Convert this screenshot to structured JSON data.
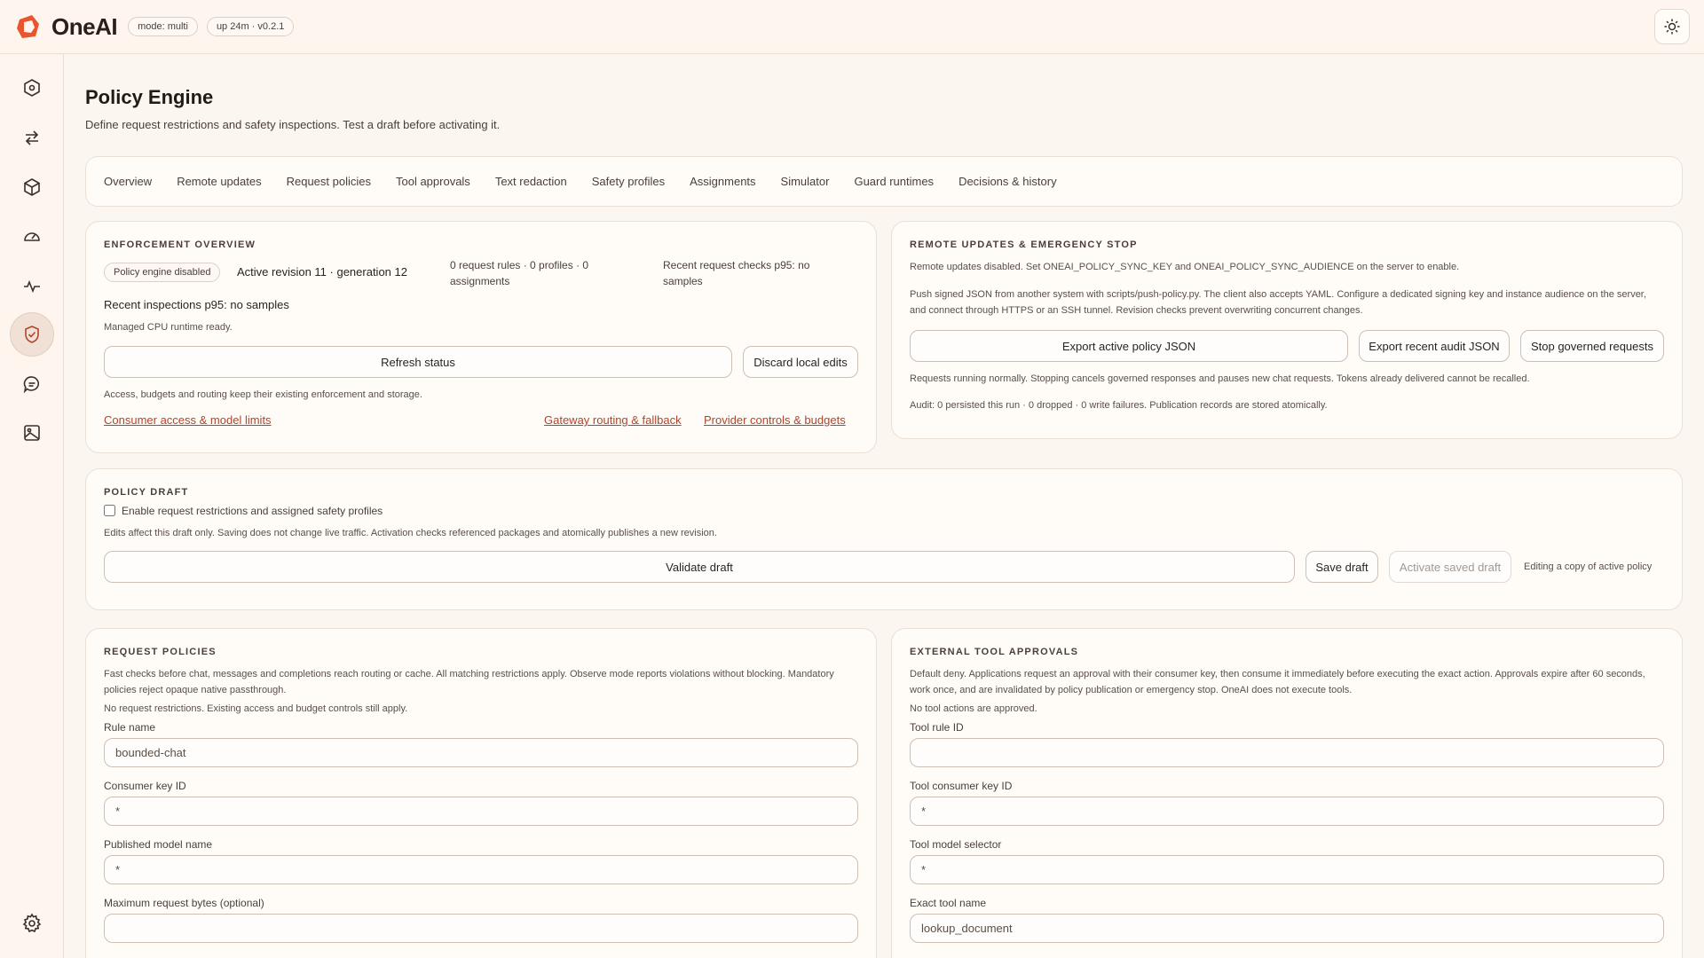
{
  "header": {
    "brand": "OneAI",
    "mode_pill": "mode: multi",
    "uptime_pill": "up 24m · v0.2.1",
    "theme_icon": "sun-icon"
  },
  "sidebar": {
    "items": [
      {
        "icon": "hub-icon"
      },
      {
        "icon": "arrows-swap-icon"
      },
      {
        "icon": "cube-icon"
      },
      {
        "icon": "gauge-icon"
      },
      {
        "icon": "pulse-icon"
      },
      {
        "icon": "shield-check-icon",
        "active": true
      },
      {
        "icon": "chat-icon"
      },
      {
        "icon": "image-icon"
      }
    ],
    "settings_icon": "gear-icon"
  },
  "page": {
    "title": "Policy Engine",
    "subtitle": "Define request restrictions and safety inspections. Test a draft before activating it."
  },
  "tabs": [
    "Overview",
    "Remote updates",
    "Request policies",
    "Tool approvals",
    "Text redaction",
    "Safety profiles",
    "Assignments",
    "Simulator",
    "Guard runtimes",
    "Decisions & history"
  ],
  "enforcement": {
    "title": "ENFORCEMENT OVERVIEW",
    "status_badge": "Policy engine disabled",
    "revision": "Active revision 11 · generation 12",
    "counts": "0 request rules · 0 profiles · 0 assignments",
    "p95_checks": "Recent request checks p95: no samples",
    "p95_inspections": "Recent inspections p95: no samples",
    "runtime": "Managed CPU runtime ready.",
    "refresh_label": "Refresh status",
    "discard_label": "Discard local edits",
    "note": "Access, budgets and routing keep their existing enforcement and storage.",
    "link_consumer": "Consumer access & model limits",
    "link_gateway": "Gateway routing & fallback",
    "link_provider": "Provider controls & budgets"
  },
  "remote": {
    "title": "REMOTE UPDATES & EMERGENCY STOP",
    "disabled_note": "Remote updates disabled. Set ONEAI_POLICY_SYNC_KEY and ONEAI_POLICY_SYNC_AUDIENCE on the server to enable.",
    "push_note": "Push signed JSON from another system with scripts/push-policy.py. The client also accepts YAML. Configure a dedicated signing key and instance audience on the server, and connect through HTTPS or an SSH tunnel. Revision checks prevent overwriting concurrent changes.",
    "export_policy_label": "Export active policy JSON",
    "export_audit_label": "Export recent audit JSON",
    "stop_label": "Stop governed requests",
    "running_note": "Requests running normally. Stopping cancels governed responses and pauses new chat requests. Tokens already delivered cannot be recalled.",
    "audit_note": "Audit: 0 persisted this run · 0 dropped · 0 write failures. Publication records are stored atomically."
  },
  "draft": {
    "title": "POLICY DRAFT",
    "checkbox_label": "Enable request restrictions and assigned safety profiles",
    "note": "Edits affect this draft only. Saving does not change live traffic. Activation checks referenced packages and atomically publishes a new revision.",
    "validate_label": "Validate draft",
    "save_label": "Save draft",
    "activate_label": "Activate saved draft",
    "editing_note": "Editing a copy of active policy"
  },
  "request_policies": {
    "title": "REQUEST POLICIES",
    "description": "Fast checks before chat, messages and completions reach routing or cache. All matching restrictions apply. Observe mode reports violations without blocking. Mandatory policies reject opaque native passthrough.",
    "empty_note": "No request restrictions. Existing access and budget controls still apply.",
    "rule_name_label": "Rule name",
    "rule_name_value": "bounded-chat",
    "consumer_key_label": "Consumer key ID",
    "consumer_key_value": "*",
    "model_name_label": "Published model name",
    "model_name_value": "*",
    "max_bytes_label": "Maximum request bytes (optional)",
    "max_bytes_value": ""
  },
  "tool_approvals": {
    "title": "EXTERNAL TOOL APPROVALS",
    "description": "Default deny. Applications request an approval with their consumer key, then consume it immediately before executing the exact action. Approvals expire after 60 seconds, work once, and are invalidated by policy publication or emergency stop. OneAI does not execute tools.",
    "empty_note": "No tool actions are approved.",
    "rule_id_label": "Tool rule ID",
    "rule_id_value": "",
    "consumer_key_label": "Tool consumer key ID",
    "consumer_key_value": "*",
    "model_selector_label": "Tool model selector",
    "model_selector_value": "*",
    "tool_name_label": "Exact tool name",
    "tool_name_value": "lookup_document"
  },
  "colors": {
    "accent": "#b0452d",
    "background": "#fcf6f1",
    "card": "#fffbf7"
  }
}
